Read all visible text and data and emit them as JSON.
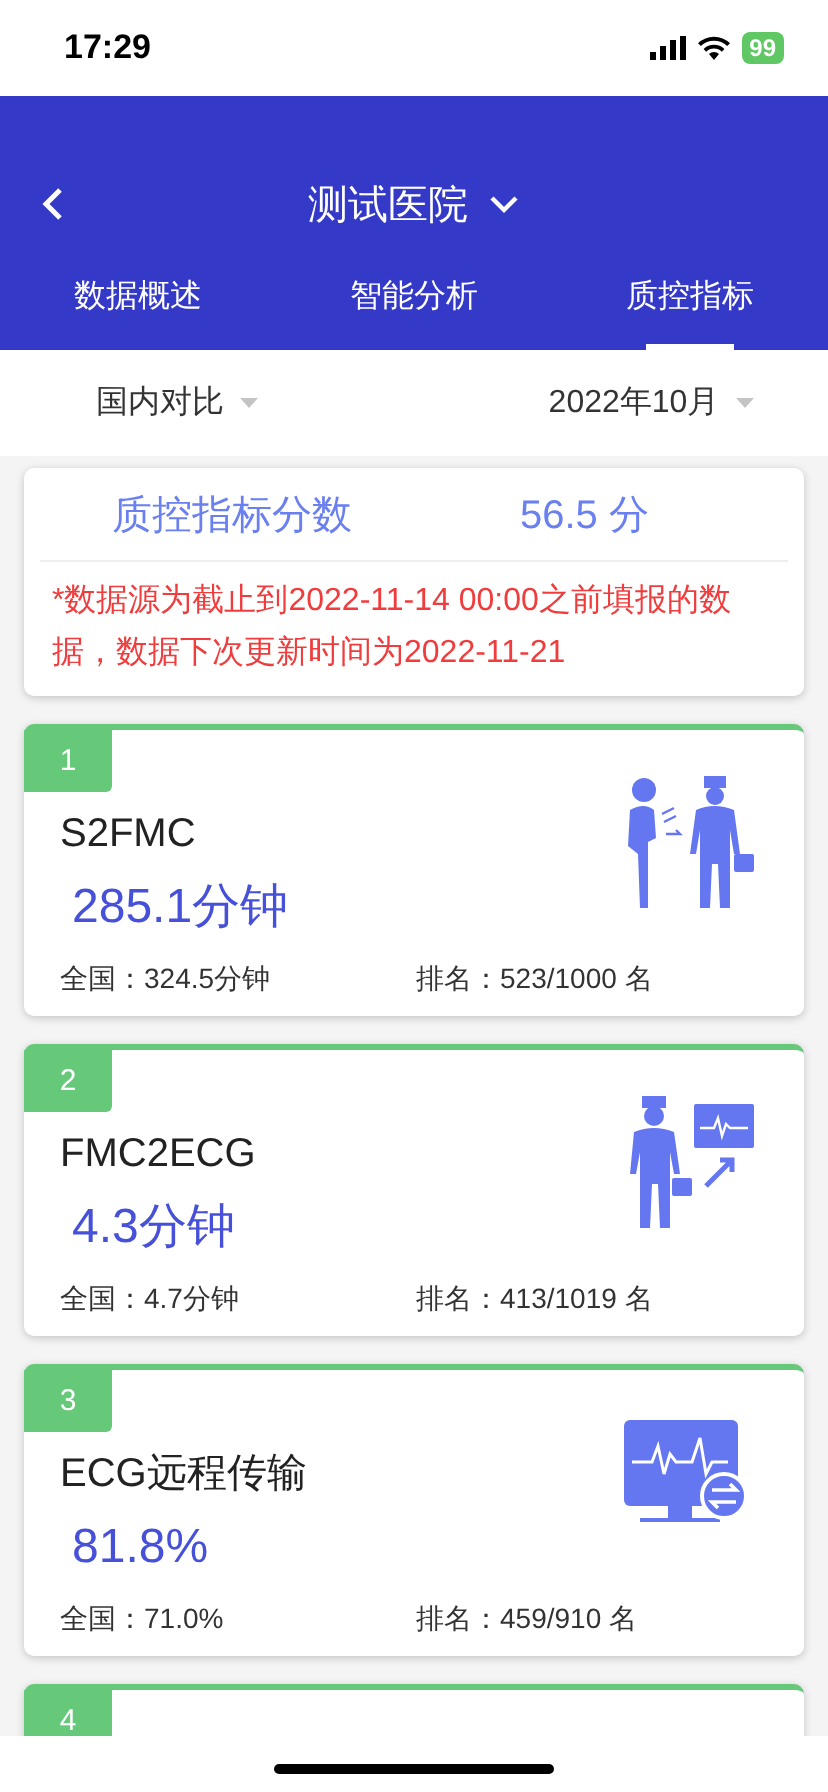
{
  "status_bar": {
    "time": "17:29",
    "battery": "99"
  },
  "header": {
    "title": "测试医院"
  },
  "tabs": [
    {
      "label": "数据概述",
      "selected": false
    },
    {
      "label": "智能分析",
      "selected": false
    },
    {
      "label": "质控指标",
      "selected": true
    }
  ],
  "filters": [
    {
      "label": "国内对比"
    },
    {
      "label": "2022年10月"
    }
  ],
  "score": {
    "label": "质控指标分数",
    "value": "56.5 分",
    "note": "*数据源为截止到2022-11-14 00:00之前填报的数据，数据下次更新时间为2022-11-21"
  },
  "metrics": [
    {
      "rank": "1",
      "name": "S2FMC",
      "value": "285.1分钟",
      "national": "全国：324.5分钟",
      "ranking": "排名：523/1000 名"
    },
    {
      "rank": "2",
      "name": "FMC2ECG",
      "value": "4.3分钟",
      "national": "全国：4.7分钟",
      "ranking": "排名：413/1019 名"
    },
    {
      "rank": "3",
      "name": "ECG远程传输",
      "value": "81.8%",
      "national": "全国：71.0%",
      "ranking": "排名：459/910 名"
    },
    {
      "rank": "4"
    }
  ]
}
